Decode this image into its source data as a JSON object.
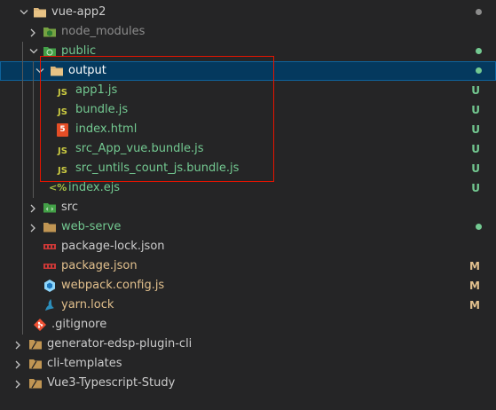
{
  "tree": {
    "items": [
      {
        "label": "vue-app2",
        "color": "#cccccc"
      },
      {
        "label": "node_modules",
        "color": "#8c8c8c"
      },
      {
        "label": "public",
        "color": "#73c991"
      },
      {
        "label": "output",
        "color": "#ffffff"
      },
      {
        "label": "app1.js",
        "color": "#73c991",
        "badge": "U"
      },
      {
        "label": "bundle.js",
        "color": "#73c991",
        "badge": "U"
      },
      {
        "label": "index.html",
        "color": "#73c991",
        "badge": "U"
      },
      {
        "label": "src_App_vue.bundle.js",
        "color": "#73c991",
        "badge": "U"
      },
      {
        "label": "src_untils_count_js.bundle.js",
        "color": "#73c991",
        "badge": "U"
      },
      {
        "label": "index.ejs",
        "color": "#73c991",
        "badge": "U"
      },
      {
        "label": "src",
        "color": "#cccccc"
      },
      {
        "label": "web-serve",
        "color": "#73c991"
      },
      {
        "label": "package-lock.json",
        "color": "#cccccc"
      },
      {
        "label": "package.json",
        "color": "#e2c08d",
        "badge": "M"
      },
      {
        "label": "webpack.config.js",
        "color": "#e2c08d",
        "badge": "M"
      },
      {
        "label": "yarn.lock",
        "color": "#e2c08d",
        "badge": "M"
      },
      {
        "label": ".gitignore",
        "color": "#cccccc"
      },
      {
        "label": "generator-edsp-plugin-cli",
        "color": "#cccccc"
      },
      {
        "label": "cli-templates",
        "color": "#cccccc"
      },
      {
        "label": "Vue3-Typescript-Study",
        "color": "#cccccc"
      }
    ],
    "js_icon_text": "JS",
    "ejs_icon_text": "<%",
    "html_icon_text": "5"
  },
  "colors": {
    "untracked": "#73c991",
    "modified": "#e2c08d",
    "selection": "#04395e",
    "highlight_box": "#e51400",
    "dot_modified": "#8c8c8c"
  }
}
